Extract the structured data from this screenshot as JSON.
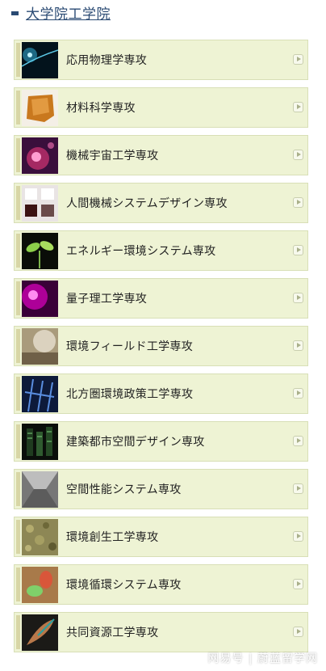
{
  "header": {
    "title": "大学院工学院"
  },
  "items": [
    {
      "label": "応用物理学専攻",
      "icon": "physics-thumbnail"
    },
    {
      "label": "材料科学専攻",
      "icon": "material-thumbnail"
    },
    {
      "label": "機械宇宙工学専攻",
      "icon": "space-thumbnail"
    },
    {
      "label": "人間機械システムデザイン専攻",
      "icon": "human-machine-thumbnail"
    },
    {
      "label": "エネルギー環境システム専攻",
      "icon": "energy-thumbnail"
    },
    {
      "label": "量子理工学専攻",
      "icon": "quantum-thumbnail"
    },
    {
      "label": "環境フィールド工学専攻",
      "icon": "field-thumbnail"
    },
    {
      "label": "北方圏環境政策工学専攻",
      "icon": "northern-thumbnail"
    },
    {
      "label": "建築都市空間デザイン専攻",
      "icon": "architecture-thumbnail"
    },
    {
      "label": "空間性能システム専攻",
      "icon": "space-performance-thumbnail"
    },
    {
      "label": "環境創生工学専攻",
      "icon": "eco-creation-thumbnail"
    },
    {
      "label": "環境循環システム専攻",
      "icon": "recycle-thumbnail"
    },
    {
      "label": "共同資源工学専攻",
      "icon": "resource-thumbnail"
    }
  ],
  "watermark": "网易号 | 蔚蓝留学网"
}
